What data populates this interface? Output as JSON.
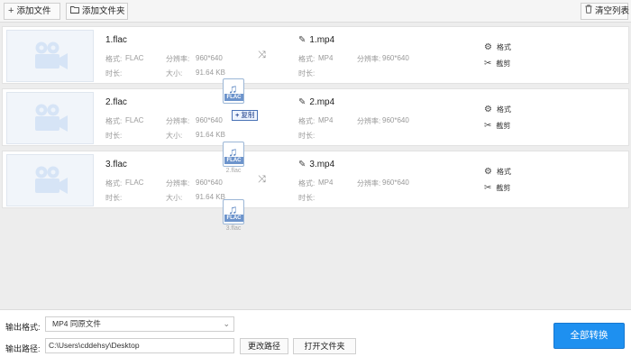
{
  "toolbar": {
    "add_file": "添加文件",
    "add_folder": "添加文件夹",
    "clear_list": "清空列表"
  },
  "labels": {
    "format": "格式:",
    "resolution": "分辨率:",
    "duration": "时长:",
    "size": "大小:"
  },
  "files": [
    {
      "name": "1.flac",
      "format": "FLAC",
      "resolution": "960*640",
      "size": "91.64 KB",
      "output_name": "1.mp4",
      "output_format": "MP4",
      "output_resolution": "960*640"
    },
    {
      "name": "2.flac",
      "format": "FLAC",
      "resolution": "960*640",
      "size": "91.64 KB",
      "output_name": "2.mp4",
      "output_format": "MP4",
      "output_resolution": "960*640"
    },
    {
      "name": "3.flac",
      "format": "FLAC",
      "resolution": "960*640",
      "size": "91.64 KB",
      "output_name": "3.mp4",
      "output_format": "MP4",
      "output_resolution": "960*640"
    }
  ],
  "actions": {
    "format": "格式",
    "trim": "截剪"
  },
  "drag": {
    "tag": "FLAC",
    "copy_label": "复制",
    "captions": [
      "2.flac",
      "3.flac"
    ]
  },
  "bottom": {
    "output_format_label": "输出格式:",
    "output_format_value": "MP4  同原文件",
    "output_path_label": "输出路径:",
    "output_path_value": "C:\\Users\\cddehsy\\Desktop",
    "change_path": "更改路径",
    "open_folder": "打开文件夹",
    "convert_all": "全部转换"
  }
}
